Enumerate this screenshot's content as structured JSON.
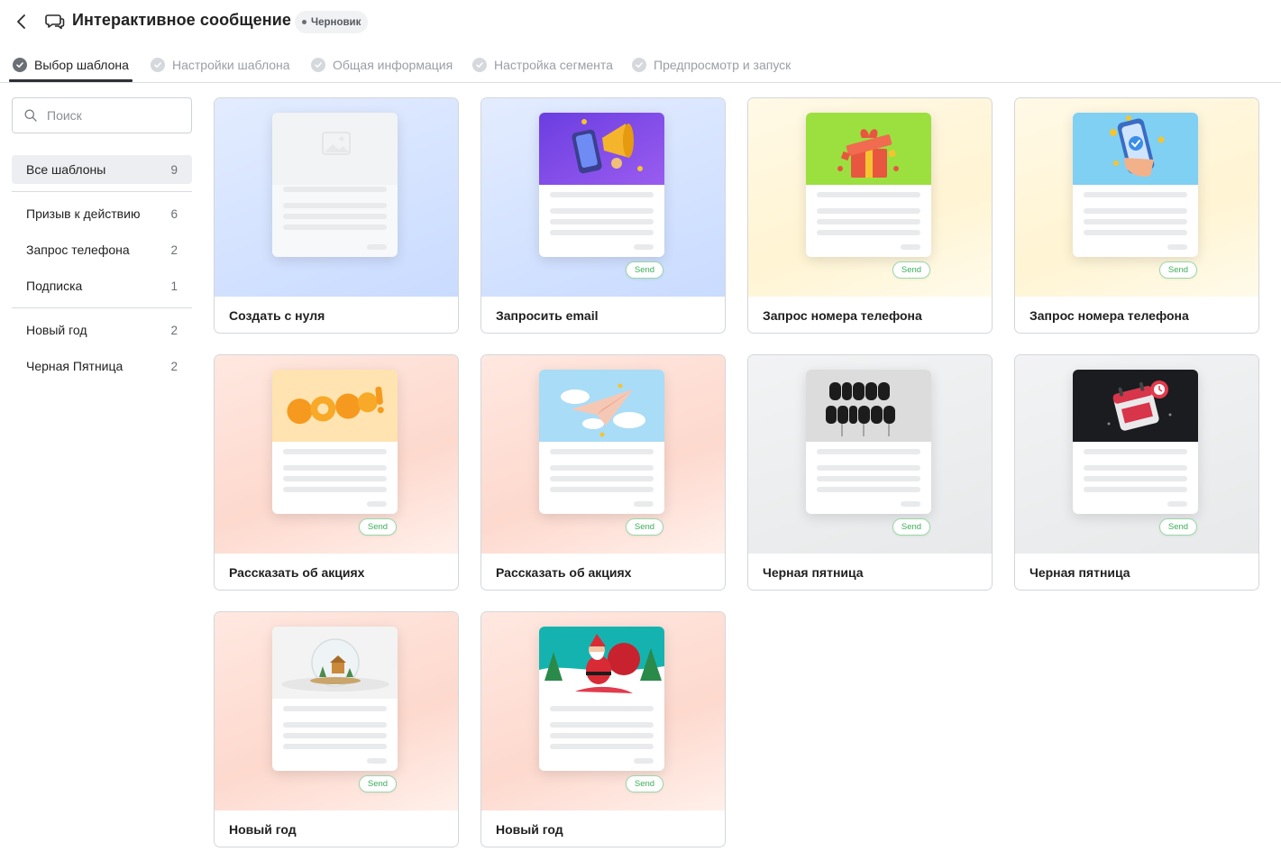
{
  "header": {
    "title": "Интерактивное сообщение",
    "status_badge": "Черновик"
  },
  "steps": [
    {
      "label": "Выбор шаблона",
      "state": "active"
    },
    {
      "label": "Настройки шаблона",
      "state": "inactive"
    },
    {
      "label": "Общая информация",
      "state": "inactive"
    },
    {
      "label": "Настройка сегмента",
      "state": "inactive"
    },
    {
      "label": "Предпросмотр и запуск",
      "state": "inactive"
    }
  ],
  "sidebar": {
    "search_placeholder": "Поиск",
    "all": {
      "label": "Все шаблоны",
      "count": "9"
    },
    "group1": [
      {
        "label": "Призыв к действию",
        "count": "6"
      },
      {
        "label": "Запрос телефона",
        "count": "2"
      },
      {
        "label": "Подписка",
        "count": "1"
      }
    ],
    "group2": [
      {
        "label": "Новый год",
        "count": "2"
      },
      {
        "label": "Черная Пятница",
        "count": "2"
      }
    ]
  },
  "templates": [
    {
      "label": "Создать с нуля",
      "send": "",
      "image": "image-placeholder-icon"
    },
    {
      "label": "Запросить email",
      "send": "Send",
      "image": "megaphone-phone-illustration"
    },
    {
      "label": "Запрос номера телефона",
      "send": "Send",
      "image": "gift-box-illustration"
    },
    {
      "label": "Запрос номера телефона",
      "send": "Send",
      "image": "phone-in-hand-illustration"
    },
    {
      "label": "Рассказать об акциях",
      "send": "Send",
      "image": "wow-text-illustration"
    },
    {
      "label": "Рассказать об акциях",
      "send": "Send",
      "image": "paper-plane-illustration"
    },
    {
      "label": "Черная пятница",
      "send": "Send",
      "image": "black-friday-balloons-illustration"
    },
    {
      "label": "Черная пятница",
      "send": "Send",
      "image": "black-friday-calendar-illustration"
    },
    {
      "label": "Новый год",
      "send": "Send",
      "image": "snow-globe-illustration"
    },
    {
      "label": "Новый год",
      "send": "Send",
      "image": "santa-claus-illustration"
    }
  ],
  "colors": {
    "send_green": "#3dae5a",
    "active_step": "#2d3035",
    "muted_text": "#9a9ea5"
  }
}
